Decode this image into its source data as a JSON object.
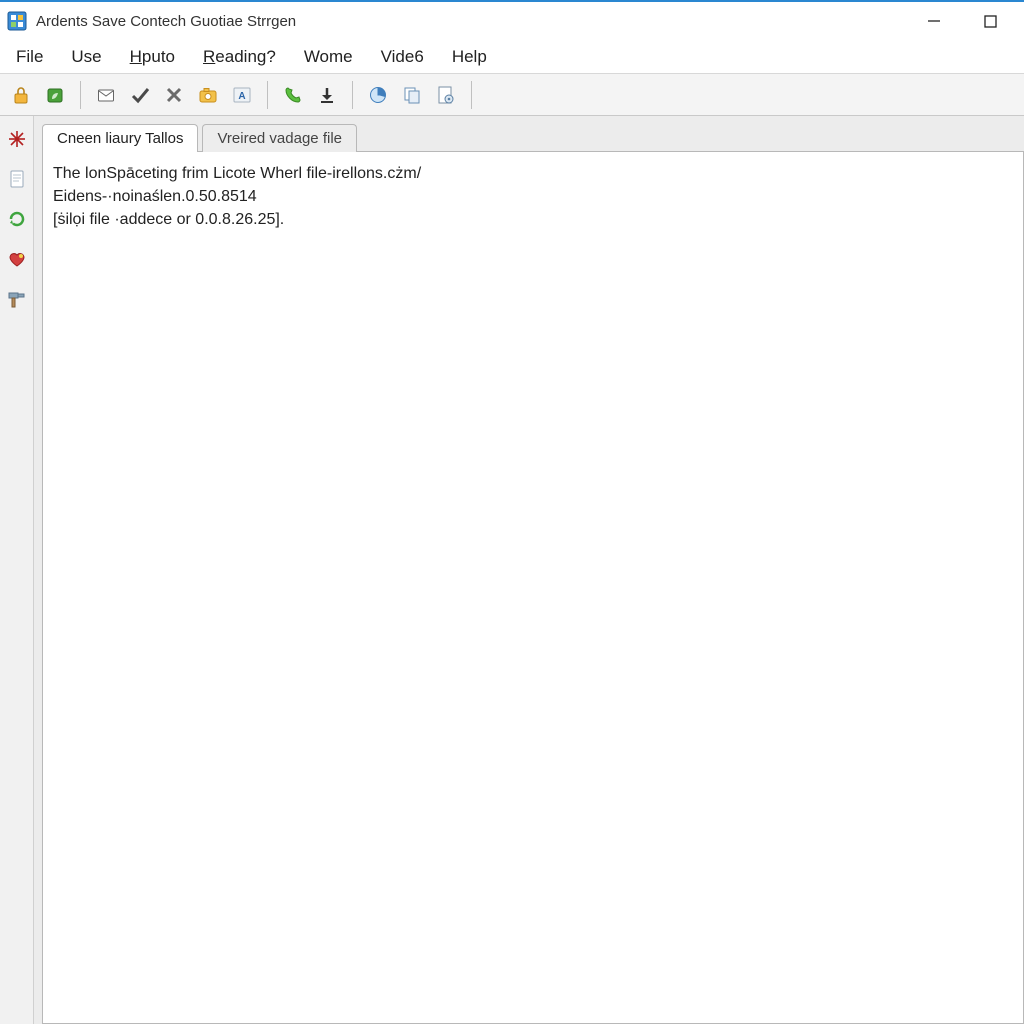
{
  "window": {
    "title": "Ardents Save Contech Guotiae Strrgen"
  },
  "menubar": {
    "items": [
      {
        "label": "File",
        "underline": -1
      },
      {
        "label": "Use",
        "underline": -1
      },
      {
        "label": "Hputo",
        "underline": 0
      },
      {
        "label": "Reading?",
        "underline": 0
      },
      {
        "label": "Wome",
        "underline": -1
      },
      {
        "label": "Vide6",
        "underline": -1
      },
      {
        "label": "Help",
        "underline": -1
      }
    ]
  },
  "toolbar_icons": [
    "lock-icon",
    "leaf-icon",
    "mail-icon",
    "check-icon",
    "cross-icon",
    "camera-icon",
    "text-a-icon",
    "phone-icon",
    "download-icon",
    "pie-icon",
    "copy-icon",
    "gear-page-icon"
  ],
  "side_icons": [
    "spark-icon",
    "page-icon",
    "refresh-green-icon",
    "heart-icon",
    "hammer-icon"
  ],
  "tabs": [
    {
      "label": "Cneen liaury Tallos",
      "active": true
    },
    {
      "label": "Vreired vadage file",
      "active": false
    }
  ],
  "document": {
    "lines": [
      "The lonSpāceting frim Licote Wherl file-irellons.cżm/",
      "Eidens-·noinaślen.0.50.8514",
      "[ṡilọi file ·addece or 0.0.8.26.25]."
    ]
  }
}
